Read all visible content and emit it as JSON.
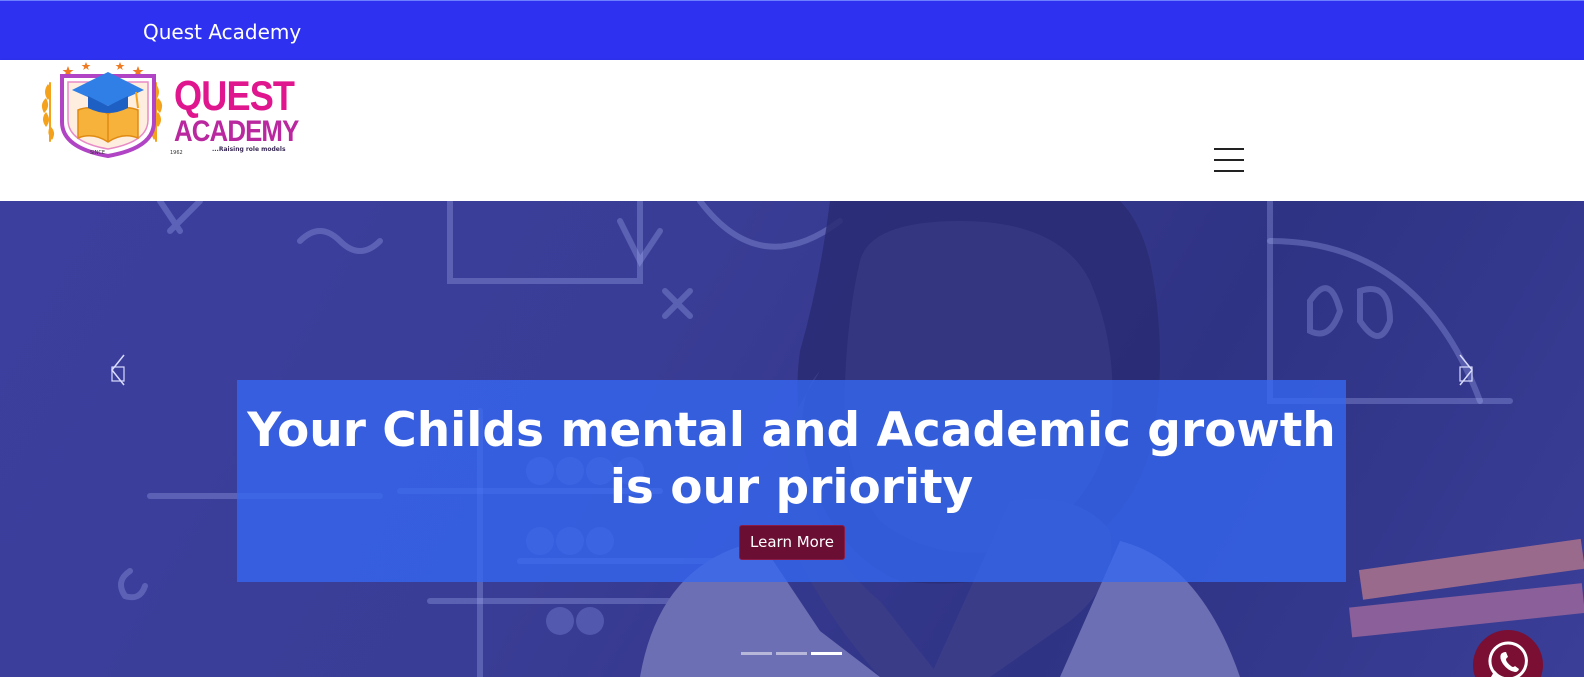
{
  "topbar": {
    "title": "Quest Academy"
  },
  "logo": {
    "word_top": "QUEST",
    "word_bottom": "ACADEMY",
    "tagline": "...Raising role models",
    "since": "SINCE",
    "year": "1962",
    "icon": "graduation-cap-book-crest"
  },
  "nav": {
    "menu_icon": "hamburger-icon"
  },
  "hero": {
    "title": "Your Childs mental and Academic growth is our priority",
    "button_label": "Learn More",
    "prev_icon": "chevron-left-icon",
    "next_icon": "chevron-right-icon",
    "slides": 3,
    "active_slide": 3
  },
  "floating": {
    "icon": "whatsapp-icon"
  },
  "colors": {
    "topbar": "#2e32f0",
    "brand_pink": "#e0168f",
    "brand_purple": "#b9289f",
    "caption_overlay": "#3468f2",
    "button": "#6b0e34",
    "whatsapp_bg": "#7a0f33"
  }
}
